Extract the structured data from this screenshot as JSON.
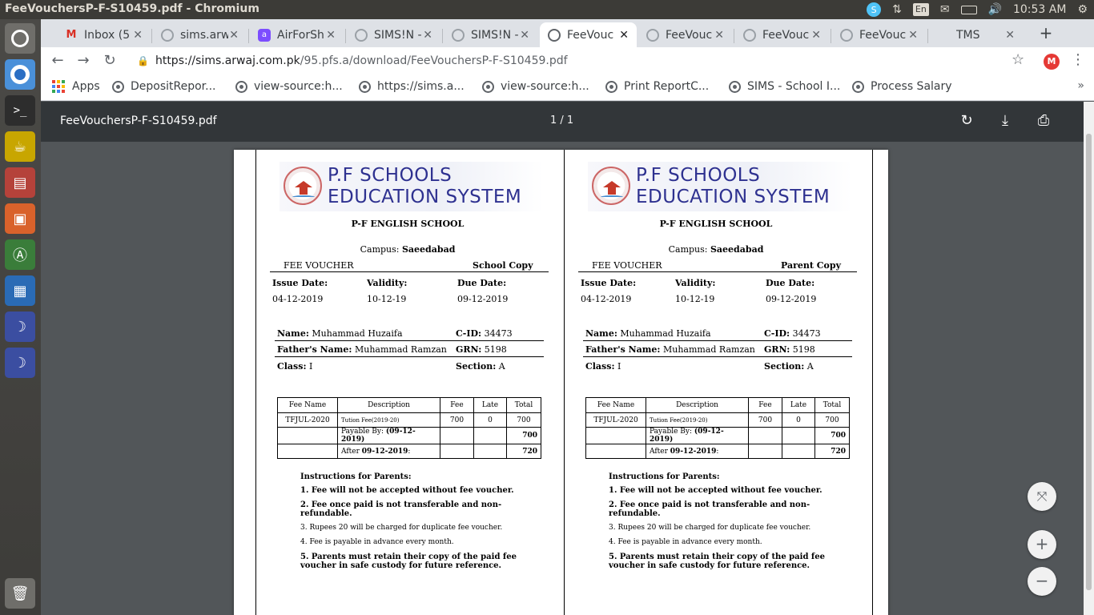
{
  "window": {
    "title": "FeeVouchersP-F-S10459.pdf - Chromium"
  },
  "tray": {
    "lang": "En",
    "volume": "🔊",
    "time": "10:53 AM"
  },
  "tabs": [
    {
      "title": "Inbox (5",
      "favicon": "gmail-icon",
      "color": "#d93025"
    },
    {
      "title": "sims.arw",
      "favicon": "globe-icon",
      "color": "#9aa0a6"
    },
    {
      "title": "AirForSh",
      "favicon": "airforshare-icon",
      "color": "#7c4dff"
    },
    {
      "title": "SIMS!N -",
      "favicon": "globe-icon",
      "color": "#9aa0a6"
    },
    {
      "title": "SIMS!N -",
      "favicon": "globe-icon",
      "color": "#9aa0a6"
    },
    {
      "title": "FeeVouc",
      "favicon": "globe-icon",
      "color": "#5f6368"
    },
    {
      "title": "FeeVouc",
      "favicon": "globe-icon",
      "color": "#9aa0a6"
    },
    {
      "title": "FeeVouc",
      "favicon": "globe-icon",
      "color": "#9aa0a6"
    },
    {
      "title": "FeeVouc",
      "favicon": "globe-icon",
      "color": "#9aa0a6"
    },
    {
      "title": "TMS",
      "favicon": "blank-icon",
      "color": "#dee1e6"
    }
  ],
  "toolbar": {
    "url_host": "https://sims.arwaj.com.pk",
    "url_path": "/95.pfs.a/download/FeeVouchersP-F-S10459.pdf",
    "profile_initial": "M"
  },
  "bookmarks": {
    "apps": "Apps",
    "items": [
      "DepositRepor...",
      "view-source:h...",
      "https://sims.a...",
      "view-source:h...",
      "Print ReportC...",
      "SIMS - School I...",
      "Process Salary"
    ],
    "more": "»"
  },
  "pdf": {
    "filename": "FeeVouchersP-F-S10459.pdf",
    "pages": "1 / 1"
  },
  "voucher": {
    "logo_line1": "P.F SCHOOLS",
    "logo_line2": "EDUCATION SYSTEM",
    "school": "P-F ENGLISH SCHOOL",
    "campus_label": "Campus:",
    "campus": "Saeedabad",
    "title": "FEE VOUCHER",
    "issue_label": "Issue Date:",
    "validity_label": "Validity:",
    "due_label": "Due Date:",
    "issue_date": "04-12-2019",
    "validity": "10-12-19",
    "due_date": "09-12-2019",
    "name_label": "Name:",
    "name": "Muhammad Huzaifa",
    "cid_label": "C-ID:",
    "cid": "34473",
    "father_label": "Father's Name:",
    "father": "Muhammad Ramzan",
    "grn_label": "GRN:",
    "grn": "5198",
    "class_label": "Class:",
    "class": "I",
    "section_label": "Section:",
    "section": "A",
    "table": {
      "headers": [
        "Fee Name",
        "Description",
        "Fee",
        "Late",
        "Total"
      ],
      "row": {
        "fee_name": "TFJUL-2020",
        "description": "Tution Fee(2019-20)",
        "fee": "700",
        "late": "0",
        "total": "700"
      },
      "payable_label": "Payable By:",
      "payable_date": "(09-12-2019)",
      "payable_total": "700",
      "after_label": "After",
      "after_date": "09-12-2019",
      "after_total": "720"
    },
    "instructions_title": "Instructions for Parents:",
    "instructions": [
      "1. Fee will not be accepted without fee voucher.",
      "2. Fee once paid is not transferable and non-refundable.",
      "3. Rupees 20 will be charged for duplicate fee voucher.",
      "4. Fee is payable in advance every month.",
      "5. Parents must retain their copy of the paid fee voucher in safe custody for future reference."
    ],
    "copies": [
      "School Copy",
      "Parent Copy"
    ]
  },
  "colors": {
    "logo_text": "#2e3190",
    "pdf_toolbar": "#323639",
    "viewer_bg": "#525659"
  }
}
